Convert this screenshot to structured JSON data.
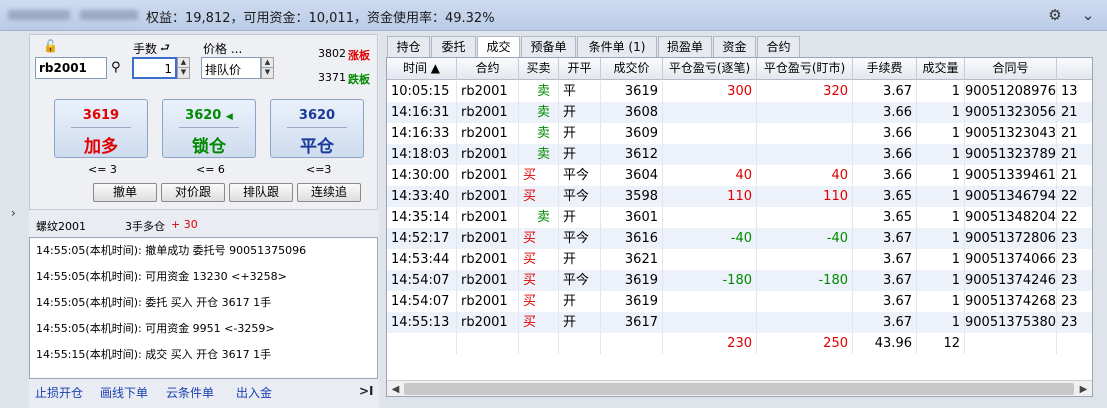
{
  "header": {
    "summary": "权益：19,812，可用资金：10,011，资金使用率：49.32%"
  },
  "order": {
    "qty_label": "手数",
    "price_label": "价格 ...",
    "contract": "rb2001",
    "qty": "1",
    "price_type": "排队价",
    "limit_up": "3802",
    "limit_up_tag": "涨板",
    "limit_down": "3371",
    "limit_down_tag": "跌板",
    "buttons": [
      {
        "price": "3619",
        "label": "加多",
        "limit": "<= 3",
        "price_color": "#e00000",
        "label_color": "#e00000"
      },
      {
        "price": "3620",
        "label": "锁仓",
        "limit": "<= 6",
        "price_color": "#008a00",
        "label_color": "#008a00"
      },
      {
        "price": "3620",
        "label": "平仓",
        "limit": "<=3",
        "price_color": "#1a3a9a",
        "label_color": "#1a3a9a"
      }
    ],
    "actions": [
      "撤单",
      "对价跟",
      "排队跟",
      "连续追"
    ]
  },
  "position": {
    "name": "螺纹2001",
    "holding": "3手多仓",
    "pnl": "+ 30"
  },
  "log": [
    "14:55:05(本机时间): 撤单成功 委托号 90051375096",
    "14:55:05(本机时间): 可用资金 13230 <+3258>",
    "14:55:05(本机时间): 委托 买入 开仓 3617 1手",
    "14:55:05(本机时间): 可用资金 9951 <-3259>",
    "14:55:15(本机时间): 成交 买入 开仓 3617 1手"
  ],
  "footer": [
    "止损开仓",
    "画线下单",
    "云条件单",
    "出入金"
  ],
  "footer_end": ">I",
  "tabs": [
    "持仓",
    "委托",
    "成交",
    "预备单",
    "条件单 (1)",
    "损盈单",
    "资金",
    "合约"
  ],
  "active_tab": 2,
  "columns": [
    "时间 ▲",
    "合约",
    "买卖",
    "开平",
    "成交价",
    "平仓盈亏(逐笔)",
    "平仓盈亏(盯市)",
    "手续费",
    "成交量",
    "合同号"
  ],
  "rows": [
    [
      "10:05:15",
      "rb2001",
      "卖",
      "平",
      "3619",
      "300",
      "320",
      "3.67",
      "1",
      "90051208976",
      "13"
    ],
    [
      "14:16:31",
      "rb2001",
      "卖",
      "开",
      "3608",
      "",
      "",
      "3.66",
      "1",
      "90051323056",
      "21"
    ],
    [
      "14:16:33",
      "rb2001",
      "卖",
      "开",
      "3609",
      "",
      "",
      "3.66",
      "1",
      "90051323043",
      "21"
    ],
    [
      "14:18:03",
      "rb2001",
      "卖",
      "开",
      "3612",
      "",
      "",
      "3.66",
      "1",
      "90051323789",
      "21"
    ],
    [
      "14:30:00",
      "rb2001",
      "买",
      "平今",
      "3604",
      "40",
      "40",
      "3.66",
      "1",
      "90051339461",
      "21"
    ],
    [
      "14:33:40",
      "rb2001",
      "买",
      "平今",
      "3598",
      "110",
      "110",
      "3.65",
      "1",
      "90051346794",
      "22"
    ],
    [
      "14:35:14",
      "rb2001",
      "卖",
      "开",
      "3601",
      "",
      "",
      "3.65",
      "1",
      "90051348204",
      "22"
    ],
    [
      "14:52:17",
      "rb2001",
      "买",
      "平今",
      "3616",
      "-40",
      "-40",
      "3.67",
      "1",
      "90051372806",
      "23"
    ],
    [
      "14:53:44",
      "rb2001",
      "买",
      "开",
      "3621",
      "",
      "",
      "3.67",
      "1",
      "90051374066",
      "23"
    ],
    [
      "14:54:07",
      "rb2001",
      "买",
      "平今",
      "3619",
      "-180",
      "-180",
      "3.67",
      "1",
      "90051374246",
      "23"
    ],
    [
      "14:54:07",
      "rb2001",
      "买",
      "开",
      "3619",
      "",
      "",
      "3.67",
      "1",
      "90051374268",
      "23"
    ],
    [
      "14:55:13",
      "rb2001",
      "买",
      "开",
      "3617",
      "",
      "",
      "3.67",
      "1",
      "90051375380",
      "23"
    ]
  ],
  "totals": [
    "230",
    "250",
    "43.96",
    "12"
  ],
  "colors": {
    "buy": "#e00000",
    "sell": "#008a00",
    "loss": "#008a00",
    "profit": "#e00000"
  }
}
